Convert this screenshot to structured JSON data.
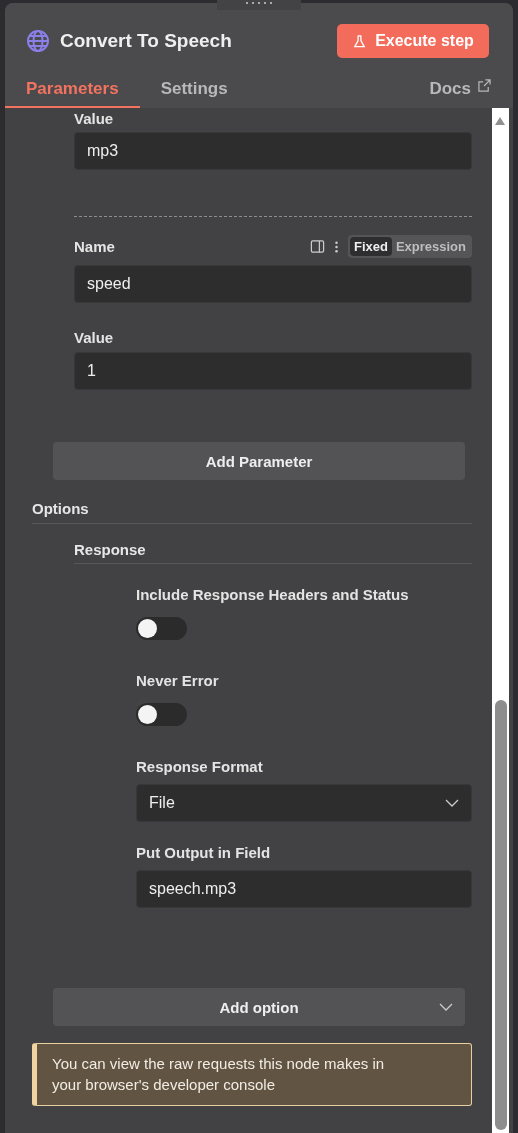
{
  "header": {
    "title": "Convert To Speech",
    "execute_button": "Execute step"
  },
  "tabs": [
    {
      "label": "Parameters",
      "selected": true
    },
    {
      "label": "Settings",
      "selected": false
    }
  ],
  "docs_link": "Docs",
  "parameters": [
    {
      "value_label": "Value",
      "value": "mp3"
    },
    {
      "name_label": "Name",
      "name": "speed",
      "modes": [
        {
          "label": "Fixed",
          "selected": true
        },
        {
          "label": "Expression",
          "selected": false
        }
      ],
      "value_label": "Value",
      "value": "1"
    }
  ],
  "add_parameter": "Add Parameter",
  "options": {
    "title": "Options",
    "group": "Response",
    "items": [
      {
        "kind": "toggle",
        "label": "Include Response Headers and Status",
        "on": false
      },
      {
        "kind": "toggle",
        "label": "Never Error",
        "on": false
      },
      {
        "kind": "select",
        "label": "Response Format",
        "value": "File"
      },
      {
        "kind": "text",
        "label": "Put Output in Field",
        "value": "speech.mp3"
      }
    ]
  },
  "add_option": "Add option",
  "notice": "You can view the raw requests this node makes in your browser's developer console"
}
